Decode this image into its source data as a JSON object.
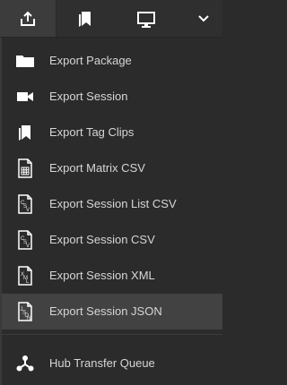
{
  "toolbar": {
    "buttons": [
      {
        "name": "export-button",
        "icon": "export-upload-icon",
        "active": true
      },
      {
        "name": "bookmarks-button",
        "icon": "bookmark-icon",
        "active": false
      },
      {
        "name": "monitor-button",
        "icon": "monitor-icon",
        "active": false
      },
      {
        "name": "more-chevron-button",
        "icon": "chevron-down-icon",
        "active": false
      }
    ]
  },
  "menu": {
    "items": [
      {
        "label": "Export Package",
        "icon": "folder-icon"
      },
      {
        "label": "Export Session",
        "icon": "video-camera-icon"
      },
      {
        "label": "Export Tag Clips",
        "icon": "bookmark-tag-icon"
      },
      {
        "label": "Export Matrix CSV",
        "icon": "matrix-grid-file-icon"
      },
      {
        "label": "Export Session List CSV",
        "icon": "csv-file-icon"
      },
      {
        "label": "Export Session CSV",
        "icon": "csv-file-icon"
      },
      {
        "label": "Export Session XML",
        "icon": "xml-file-icon"
      },
      {
        "label": "Export Session JSON",
        "icon": "json-file-icon",
        "highlighted": true
      },
      {
        "label": "Hub Transfer Queue",
        "icon": "hub-network-icon"
      }
    ]
  },
  "colors": {
    "background": "#2b2b2b",
    "highlight": "#424242",
    "text": "#d6d6d6",
    "icon": "#ffffff"
  }
}
